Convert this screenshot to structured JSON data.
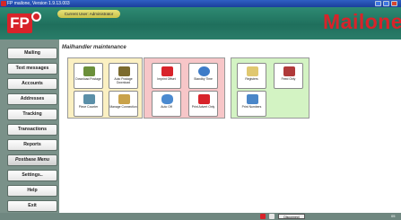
{
  "window": {
    "title": "FP mailone, Version 1.9.13.003"
  },
  "header": {
    "user_banner": "Current User: Administrator",
    "brand": "Mailone"
  },
  "sidebar": {
    "items": [
      {
        "label": "Mailing"
      },
      {
        "label": "Text messages"
      },
      {
        "label": "Accounts"
      },
      {
        "label": "Addresses"
      },
      {
        "label": "Tracking"
      },
      {
        "label": "Transactions"
      },
      {
        "label": "Reports"
      },
      {
        "label": "Postbase Menu",
        "active": true
      },
      {
        "label": "Settings.."
      },
      {
        "label": "Help"
      },
      {
        "label": "Exit"
      }
    ]
  },
  "main": {
    "title": "Mailhandler maintenance",
    "tiles": [
      {
        "label": "Download Postage"
      },
      {
        "label": "Auto Postage Download"
      },
      {
        "label": "Piece Counter"
      },
      {
        "label": "Manage Connection"
      },
      {
        "label": "Imprint Offset"
      },
      {
        "label": "Standby Time"
      },
      {
        "label": "Auto Off"
      },
      {
        "label": "Print Advert Only"
      },
      {
        "label": "Registers"
      },
      {
        "label": "Feed Only"
      },
      {
        "label": "Print Numbers"
      }
    ]
  },
  "taskbar": {
    "disconnect_label": "Disconnect",
    "end_text": "05"
  },
  "colors": {
    "brand_red": "#d8232a",
    "header_green": "#1f6f5c",
    "group_yellow": "#fbf0c2",
    "group_red": "#f7c6c8",
    "group_green": "#d3f3c3"
  }
}
